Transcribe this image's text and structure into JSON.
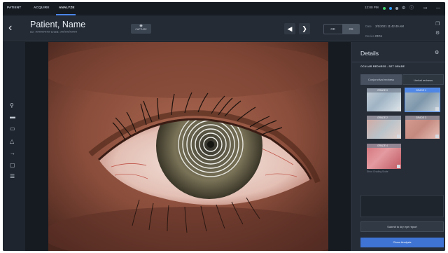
{
  "nav": {
    "tabs": [
      {
        "label": "PATIENT"
      },
      {
        "label": "ACQUIRE"
      },
      {
        "label": "ANALYZE"
      }
    ],
    "time": "12:00 PM",
    "status_colors": [
      "#3fd06b",
      "#2f9bff",
      "#9aa3ad"
    ],
    "icons": [
      "settings-icon",
      "info-icon",
      "window-icon",
      "minimize-icon"
    ]
  },
  "header": {
    "back_icon": "chevron-left-icon",
    "patient_name": "Patient, Name",
    "patient_sub": "ID: ########   DOB: ##/##/####",
    "capture_label": "CAPTURE",
    "prev_icon": "triangle-left-icon",
    "next_icon": "chevron-right-icon",
    "view_od": "OD",
    "view_os": "OS",
    "date_label": "Date",
    "date_value": "3/1/2021 11:42:49 AM",
    "device_label": "Device",
    "device_value": "IRO1"
  },
  "left_tools": [
    "zoom-icon",
    "minus-icon",
    "layout-icon",
    "triangle-icon",
    "arrow-icon",
    "comment-icon",
    "list-icon"
  ],
  "panel": {
    "title": "Details",
    "subtitle": "OCULAR REDNESS - SET GRADE",
    "tabs": [
      "Conjunctival redness",
      "Limbal redness"
    ],
    "active_tab": 0,
    "thumbnails": [
      {
        "label": "GRADE 0",
        "selected": false
      },
      {
        "label": "GRADE 1",
        "selected": true
      },
      {
        "label": "GRADE 2",
        "selected": false
      },
      {
        "label": "GRADE 3",
        "selected": false
      },
      {
        "label": "GRADE 4",
        "selected": false
      }
    ],
    "scale_note": "Efron Grading Scale",
    "submit_label": "Submit to dry eye report",
    "close_label": "Close Analysis"
  },
  "colors": {
    "accent": "#4c86e8",
    "primary_button": "#3f74d4",
    "background": "#1b2129",
    "panel": "#262d37"
  }
}
